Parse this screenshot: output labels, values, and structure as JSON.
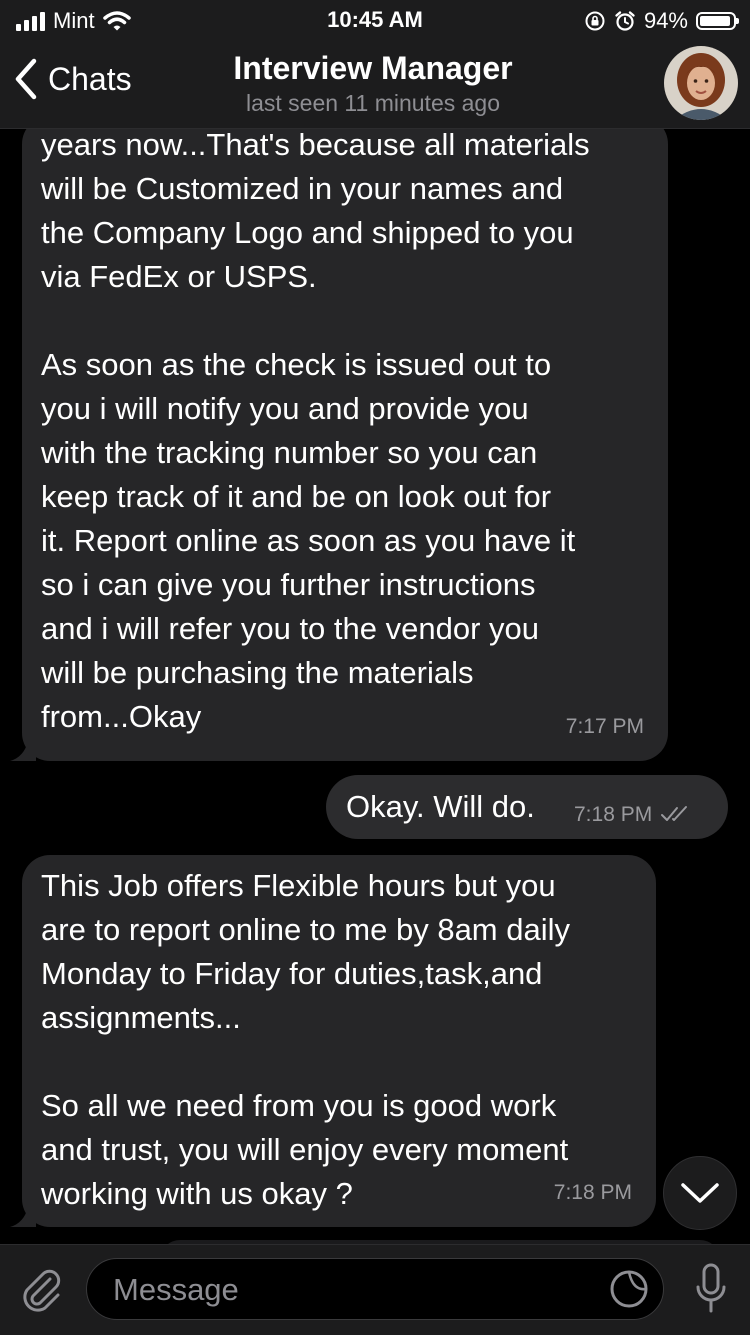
{
  "status_bar": {
    "carrier": "Mint",
    "time": "10:45 AM",
    "battery": "94%",
    "battery_level": 0.94
  },
  "header": {
    "back_label": "Chats",
    "title": "Interview Manager",
    "subtitle": "last seen 11 minutes ago"
  },
  "messages": [
    {
      "direction": "incoming",
      "text": "years now...That's because all materials\nwill be Customized in your names and\nthe Company Logo and shipped to you\nvia FedEx or USPS.\n\nAs soon as the check is issued out to\nyou i will notify you and provide you\nwith the tracking number so you can\nkeep track of it and be on look out for\nit. Report online as soon as you have it\nso i can give you further instructions\nand i will refer you to the vendor you\nwill be purchasing the materials\nfrom...Okay",
      "time": "7:17 PM"
    },
    {
      "direction": "outgoing",
      "text": "Okay. Will do.",
      "time": "7:18 PM",
      "status": "read"
    },
    {
      "direction": "incoming",
      "text": "This Job offers Flexible hours but you\nare to report online to me by 8am daily\nMonday to Friday for duties,task,and\nassignments...\n\nSo all we need from you is good work\nand trust, you will enjoy every moment\nworking with us okay ?",
      "time": "7:18 PM"
    }
  ],
  "input": {
    "placeholder": "Message"
  },
  "icons": {
    "back": "chevron-left-icon",
    "scroll_down": "chevron-down-icon",
    "attach": "paperclip-icon",
    "sticker": "sticker-icon",
    "mic": "microphone-icon"
  },
  "colors": {
    "background": "#000000",
    "bar": "#1c1c1d",
    "incoming_bubble": "#262628",
    "outgoing_bubble": "#2c2c2e",
    "timestamp": "#9a9a9e"
  }
}
